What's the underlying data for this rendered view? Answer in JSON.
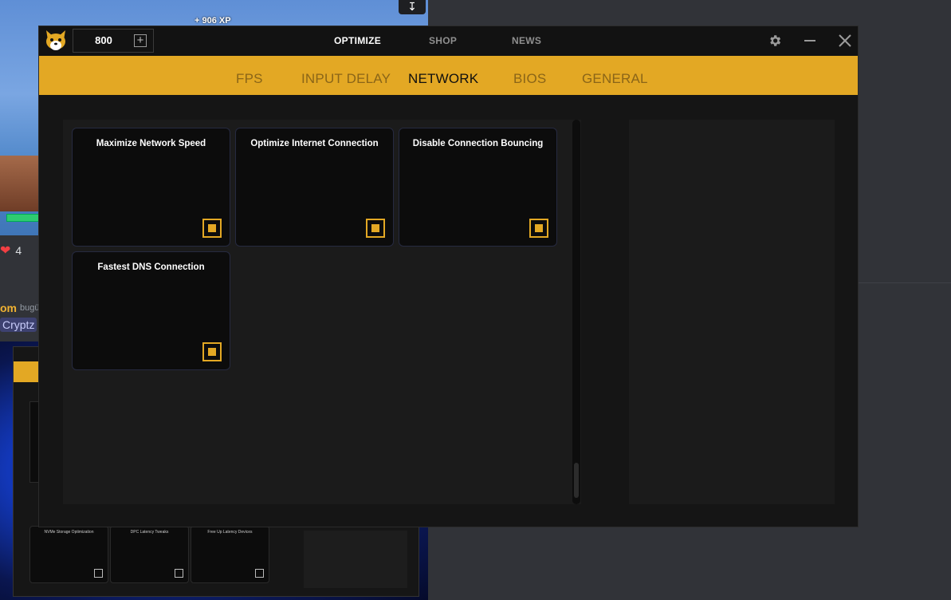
{
  "background": {
    "game_xp": "+ 906 XP",
    "reaction_count": "4",
    "message_user": "om",
    "message_time": "bugü",
    "mention": "Cryptz",
    "mini_cards": [
      "NVMe Storage Optimization",
      "DPC Latency Tweaks",
      "Free Up Latency Devices"
    ]
  },
  "app": {
    "counter_value": "800",
    "nav": [
      "OPTIMIZE",
      "SHOP",
      "NEWS"
    ],
    "tabs": [
      "FPS",
      "INPUT DELAY",
      "NETWORK",
      "BIOS",
      "GENERAL"
    ],
    "active_tab": "NETWORK",
    "cards": [
      {
        "title": "Maximize Network Speed",
        "checked": true
      },
      {
        "title": "Optimize Internet Connection",
        "checked": true
      },
      {
        "title": "Disable Connection Bouncing",
        "checked": true
      },
      {
        "title": "Fastest DNS Connection",
        "checked": true
      }
    ],
    "colors": {
      "accent": "#e3a824",
      "card_bg": "#0c0c0c",
      "window_bg": "#151515"
    }
  }
}
